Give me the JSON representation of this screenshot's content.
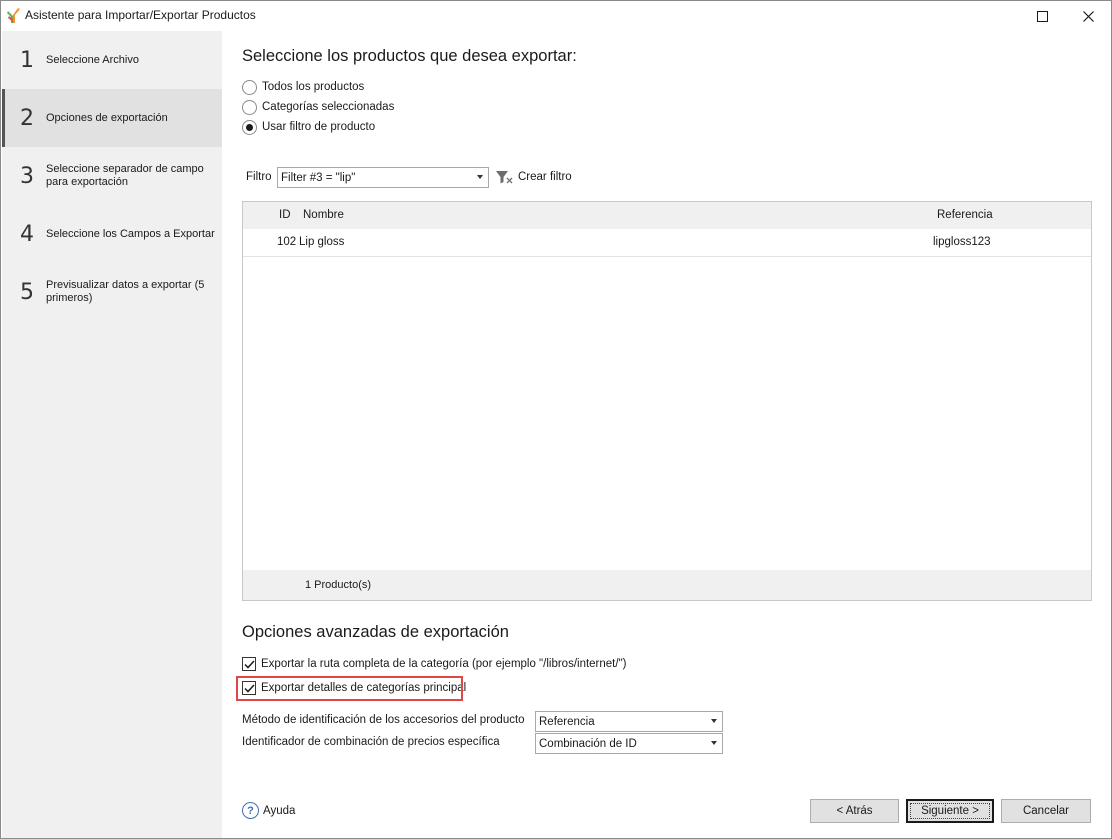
{
  "window": {
    "title": "Asistente para Importar/Exportar Productos"
  },
  "sidebar": {
    "steps": [
      {
        "num": "1",
        "label": "Seleccione Archivo"
      },
      {
        "num": "2",
        "label": "Opciones de exportación"
      },
      {
        "num": "3",
        "label": "Seleccione separador de campo para exportación"
      },
      {
        "num": "4",
        "label": "Seleccione los Campos a Exportar"
      },
      {
        "num": "5",
        "label": "Previsualizar datos a exportar (5 primeros)"
      }
    ],
    "active_step": 2
  },
  "main": {
    "heading": "Seleccione los productos que desea exportar:",
    "radios": [
      {
        "label": "Todos los productos",
        "checked": false
      },
      {
        "label": "Categorías seleccionadas",
        "checked": false
      },
      {
        "label": "Usar filtro de producto",
        "checked": true
      }
    ],
    "filter": {
      "label": "Filtro",
      "value": "Filter #3 = \"lip\"",
      "create_label": "Crear filtro"
    },
    "grid": {
      "columns": [
        "ID",
        "Nombre",
        "Referencia"
      ],
      "rows": [
        {
          "id": "102",
          "name": "Lip gloss",
          "reference": "lipgloss123"
        }
      ],
      "footer": "1 Producto(s)"
    },
    "advanced": {
      "heading": "Opciones avanzadas de exportación",
      "checks": [
        {
          "label": "Exportar la ruta completa de la categoría (por ejemplo \"/libros/internet/\")",
          "checked": true
        },
        {
          "label": "Exportar detalles de categorías principal",
          "checked": true
        }
      ],
      "accessories_label": "Método de identificación de los accesorios del producto",
      "accessories_value": "Referencia",
      "combination_label": "Identificador de combinación de precios específica",
      "combination_value": "Combinación de ID"
    }
  },
  "footer": {
    "help_label": "Ayuda",
    "back_label": "< Atrás",
    "next_label": "Siguiente >",
    "cancel_label": "Cancelar"
  },
  "colors": {
    "highlight": "#e04646",
    "sidebar_bg": "#f0f0f0",
    "sidebar_active_bg": "#e1e1e1",
    "help_blue": "#3d6fb6"
  },
  "icons": [
    "app-logo-icon",
    "maximize-icon",
    "close-icon",
    "filter-funnel-icon",
    "chevron-down-icon",
    "checkmark-icon",
    "help-question-icon"
  ]
}
